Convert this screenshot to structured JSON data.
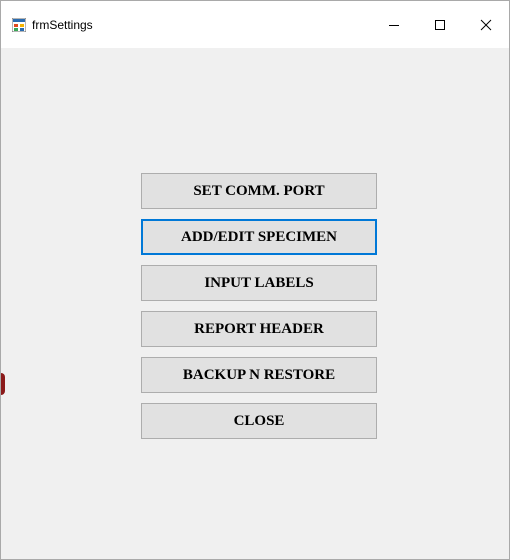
{
  "window": {
    "title": "frmSettings",
    "icon": "windows-form-icon"
  },
  "title_controls": {
    "minimize_icon": "minimize-icon",
    "maximize_icon": "maximize-icon",
    "close_icon": "close-icon"
  },
  "buttons": {
    "set_comm_port": "SET COMM. PORT",
    "add_edit_specimen": "ADD/EDIT SPECIMEN",
    "input_labels": "INPUT LABELS",
    "report_header": "REPORT HEADER",
    "backup_restore": "BACKUP N RESTORE",
    "close": "CLOSE"
  },
  "focused_button": "add_edit_specimen",
  "colors": {
    "accent_focus": "#0078d7",
    "button_face": "#e1e1e1",
    "button_border": "#adadad",
    "form_background": "#f0f0f0"
  }
}
